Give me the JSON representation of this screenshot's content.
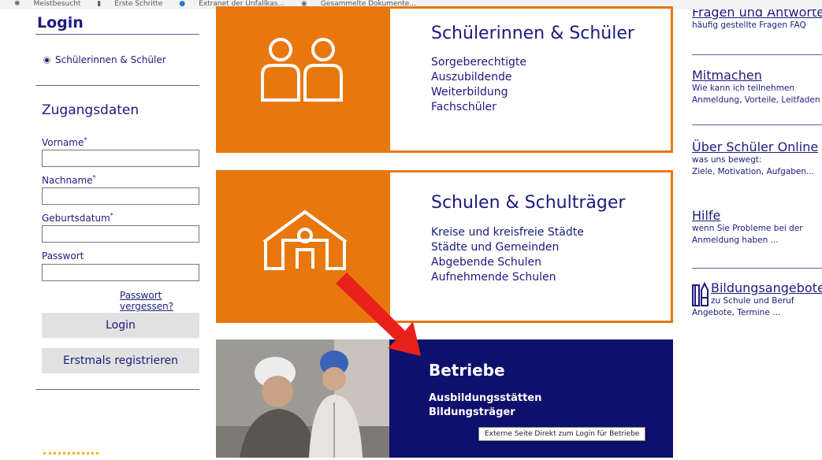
{
  "bookmarks": [
    "Meistbesucht",
    "Erste Schritte",
    "Extranet der Unfallkas...",
    "Gesammelte Dokumente..."
  ],
  "login": {
    "title": "Login",
    "role_option": "Schülerinnen & Schüler",
    "section_title": "Zugangsdaten",
    "fields": {
      "vorname": "Vorname",
      "nachname": "Nachname",
      "geburtsdatum": "Geburtsdatum",
      "passwort": "Passwort"
    },
    "required_mark": "*",
    "forgot_link": "Passwort vergessen?",
    "login_button": "Login",
    "register_button": "Erstmals registrieren"
  },
  "cards": {
    "students": {
      "title": "Schülerinnen & Schüler",
      "items": [
        "Sorgeberechtigte",
        "Auszubildende",
        "Weiterbildung",
        "Fachschüler"
      ]
    },
    "schools": {
      "title": "Schulen & Schulträger",
      "items": [
        "Kreise und kreisfreie Städte",
        "Städte und Gemeinden",
        "Abgebende Schulen",
        "Aufnehmende Schulen"
      ]
    },
    "companies": {
      "title": "Betriebe",
      "items": [
        "Ausbildungsstätten",
        "Bildungsträger"
      ],
      "tooltip": "Externe Seite Direkt zum Login für Betriebe"
    }
  },
  "right_links": {
    "faq": {
      "title": "Fragen und Antworten",
      "sub": "häufig gestellte Fragen FAQ"
    },
    "mitmachen": {
      "title": "Mitmachen",
      "sub1": "Wie kann ich teilnehmen",
      "sub2": "Anmeldung, Vorteile, Leitfaden"
    },
    "about": {
      "title": "Über Schüler Online",
      "sub1": "was uns bewegt:",
      "sub2": "Ziele, Motivation, Aufgaben..."
    },
    "hilfe": {
      "title": "Hilfe",
      "sub1": "wenn Sie Probleme bei der",
      "sub2": "Anmeldung haben ..."
    },
    "bildung": {
      "title": "Bildungsangebote",
      "sub1": "zu Schule und Beruf",
      "sub2": "Angebote, Termine ..."
    }
  },
  "colors": {
    "brand_blue": "#1b1b7d",
    "orange": "#e8770e",
    "dark_blue": "#0f0f6e",
    "arrow_red": "#e8201c"
  },
  "icons": {
    "students": "two-persons-icon",
    "schools": "school-building-icon",
    "bildung": "books-icon"
  }
}
